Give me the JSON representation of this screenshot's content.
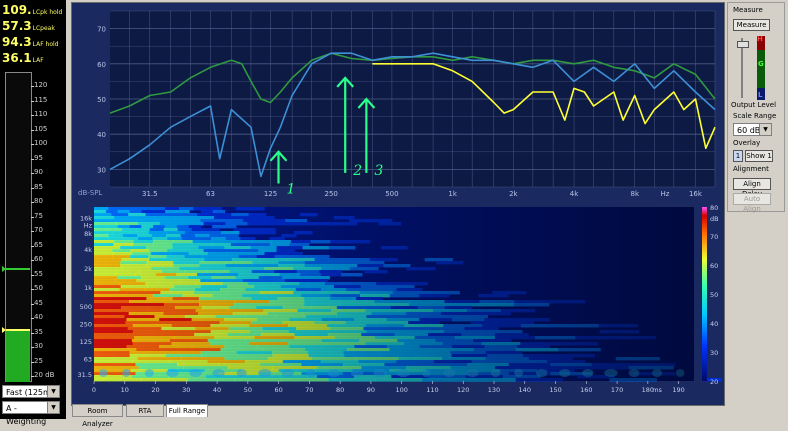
{
  "meter": {
    "readouts": [
      {
        "value": "109.",
        "unit": "LCpk hold"
      },
      {
        "value": "57.3",
        "unit": "LCpeak"
      },
      {
        "value": "94.3",
        "unit": "LAF hold"
      },
      {
        "value": "36.1",
        "unit": "LAF"
      }
    ],
    "scale": [
      "120",
      "115",
      "110",
      "105",
      "100",
      "95",
      "90",
      "85",
      "80",
      "75",
      "70",
      "65",
      "60",
      "55",
      "50",
      "45",
      "40",
      "35",
      "30",
      "25",
      "20 dB"
    ],
    "level_db": 36.1,
    "hold_green_db": 57.3,
    "hold_yellow_db": 36.1,
    "speed_select": "Fast (125ms)",
    "weighting_select": "A - Weighting"
  },
  "spl_chart": {
    "axis_label": "dB-SPL",
    "y_ticks": [
      "70",
      "60",
      "50",
      "40",
      "30"
    ],
    "x_ticks": [
      "31.5",
      "63",
      "125",
      "250",
      "500",
      "1k",
      "2k",
      "4k",
      "8k",
      "Hz",
      "16k"
    ],
    "annotations": [
      "1",
      "2",
      "3"
    ]
  },
  "chart_data": [
    {
      "type": "line",
      "title": "",
      "xlabel": "Hz",
      "ylabel": "dB-SPL",
      "xscale": "log",
      "xlim": [
        20,
        20000
      ],
      "ylim": [
        25,
        75
      ],
      "grid": true,
      "series": [
        {
          "color": "#2f9a40",
          "x": [
            20,
            25,
            31.5,
            40,
            50,
            63,
            80,
            90,
            100,
            112,
            125,
            140,
            160,
            200,
            250,
            315,
            400,
            500,
            630,
            800,
            1000,
            1250,
            1600,
            2000,
            2500,
            3150,
            4000,
            5000,
            6300,
            8000,
            10000,
            12500,
            16000,
            20000
          ],
          "y": [
            46,
            48,
            51,
            52,
            56,
            59,
            61,
            60,
            55,
            50,
            49,
            52,
            56,
            61,
            63,
            61.5,
            61,
            61.5,
            62,
            62,
            61,
            62,
            61,
            60,
            61,
            61,
            60,
            61,
            59,
            58,
            56,
            60,
            57,
            50
          ]
        },
        {
          "color": "#3d8fd6",
          "x": [
            20,
            25,
            31.5,
            40,
            50,
            63,
            70,
            80,
            100,
            112,
            125,
            140,
            160,
            200,
            250,
            315,
            400,
            500,
            630,
            800,
            1000,
            1250,
            1600,
            2000,
            2500,
            3150,
            4000,
            5000,
            6300,
            8000,
            10000,
            12500,
            16000,
            20000
          ],
          "y": [
            30,
            33,
            37,
            42,
            45,
            48,
            33,
            47,
            42,
            28,
            36,
            42,
            51,
            60,
            63,
            63,
            61,
            62,
            62,
            63,
            62,
            61,
            61,
            60,
            59,
            61,
            55,
            59,
            55,
            60,
            53,
            58,
            52,
            47
          ]
        },
        {
          "color": "#ffff33",
          "x": [
            400,
            500,
            630,
            800,
            1000,
            1250,
            1600,
            1800,
            2000,
            2500,
            3150,
            3600,
            4000,
            4500,
            5000,
            6300,
            7000,
            8000,
            9000,
            10000,
            12500,
            14000,
            16000,
            18000,
            20000
          ],
          "y": [
            60,
            60,
            60,
            60,
            58,
            55,
            49,
            46,
            47,
            52,
            52,
            44,
            53,
            52,
            48,
            52,
            44,
            51,
            43,
            47,
            52,
            47,
            50,
            36,
            42
          ]
        }
      ]
    },
    {
      "type": "heatmap",
      "title": "",
      "xlabel": "ms",
      "ylabel": "Hz",
      "x_ticks": [
        "0",
        "10",
        "20",
        "30",
        "40",
        "50",
        "60",
        "70",
        "80",
        "90",
        "100",
        "110",
        "120",
        "130",
        "140",
        "150",
        "160",
        "170",
        "180",
        "190"
      ],
      "y_ticks": [
        "16k",
        "8k",
        "4k",
        "2k",
        "1k",
        "500",
        "250",
        "125",
        "63",
        "31.5"
      ],
      "colorbar_ticks": [
        "80",
        "70",
        "60",
        "50",
        "40",
        "30",
        "20"
      ],
      "colorbar_unit": "dB",
      "xlim": [
        0,
        195
      ],
      "clim": [
        20,
        80
      ]
    }
  ],
  "tabs": [
    {
      "label": "Room Analyzer"
    },
    {
      "label": "RTA"
    },
    {
      "label": "Full Range"
    }
  ],
  "right_panel": {
    "measure_title": "Measure",
    "measure_button": "Measure",
    "level_markers": [
      "H",
      "G",
      "L"
    ],
    "output_level": "Output Level",
    "scale_range_label": "Scale Range",
    "scale_range_value": "60 dB",
    "overlay_label": "Overlay",
    "overlay_num": "1",
    "overlay_button": "Show 1",
    "alignment_label": "Alignment",
    "align_delay": "Align Delay",
    "auto_align": "Auto Align"
  },
  "colors": {
    "chart_bg": "#0d1a44",
    "grid": "#6f7b9e",
    "green_series": "#2f9a40",
    "blue_series": "#3d8fd6",
    "yellow_series": "#ffff33",
    "annotation": "#2aff8a",
    "readout": "#ffff66"
  }
}
